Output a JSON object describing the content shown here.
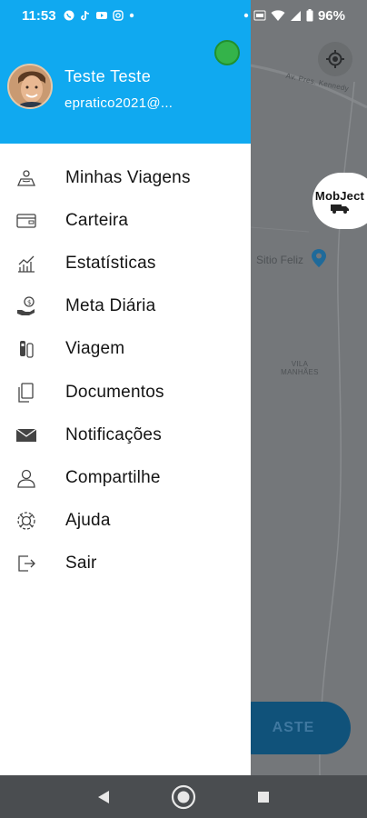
{
  "status_bar": {
    "time": "11:53",
    "battery": "96%"
  },
  "drawer": {
    "user": {
      "name": "Teste  Teste",
      "email": "epratico2021@..."
    },
    "menu": [
      {
        "label": "Minhas Viagens",
        "icon": "map-pin-user-icon"
      },
      {
        "label": "Carteira",
        "icon": "wallet-icon"
      },
      {
        "label": "Estatísticas",
        "icon": "stats-chart-icon"
      },
      {
        "label": "Meta Diária",
        "icon": "money-hand-icon"
      },
      {
        "label": "Viagem",
        "icon": "vehicles-icon"
      },
      {
        "label": "Documentos",
        "icon": "documents-icon"
      },
      {
        "label": "Notificações",
        "icon": "envelope-icon"
      },
      {
        "label": "Compartilhe",
        "icon": "person-icon"
      },
      {
        "label": "Ajuda",
        "icon": "help-icon"
      },
      {
        "label": "Sair",
        "icon": "logout-icon"
      }
    ]
  },
  "map": {
    "road_label": "Av. Pres. Kennedy",
    "place_label": "Sitio Feliz",
    "area_label": "VILA MANHÃES",
    "badge_text": "MobJect",
    "button_text": "ASTE"
  },
  "colors": {
    "header": "#10a9f0",
    "online_indicator": "#34b34a"
  }
}
